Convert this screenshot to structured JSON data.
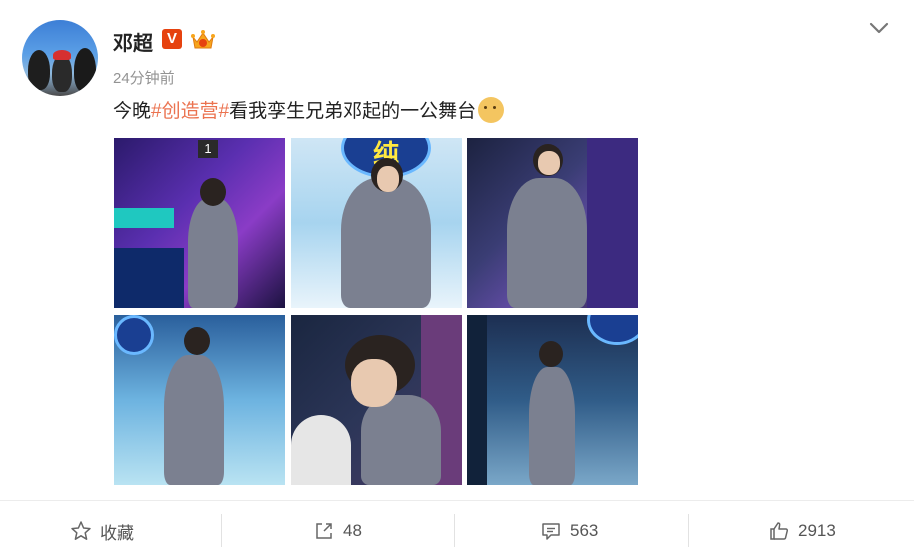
{
  "post": {
    "author": "邓超",
    "timestamp": "24分钟前",
    "text_prefix": "今晚",
    "hashtag": "#创造营#",
    "text_suffix": "看我孪生兄弟邓起的一公舞台",
    "verified_badge": "V",
    "sign_text": "纯",
    "stage_number": "1"
  },
  "icons": {
    "verified": "verified-badge-icon",
    "crown": "crown-icon",
    "menu": "chevron-down-icon",
    "emoji": "dog-face-emoji",
    "favorite": "star-icon",
    "share": "share-icon",
    "comment": "comment-icon",
    "like": "thumbs-up-icon"
  },
  "photos": [
    "stage-photo-1",
    "stage-photo-2",
    "stage-photo-3",
    "stage-photo-4",
    "stage-photo-5",
    "stage-photo-6"
  ],
  "actions": {
    "favorite_label": "收藏",
    "share_count": "48",
    "comment_count": "563",
    "like_count": "2913"
  },
  "colors": {
    "hashtag": "#eb7350",
    "verified": "#e6420f",
    "text": "#222222",
    "muted": "#939393"
  }
}
